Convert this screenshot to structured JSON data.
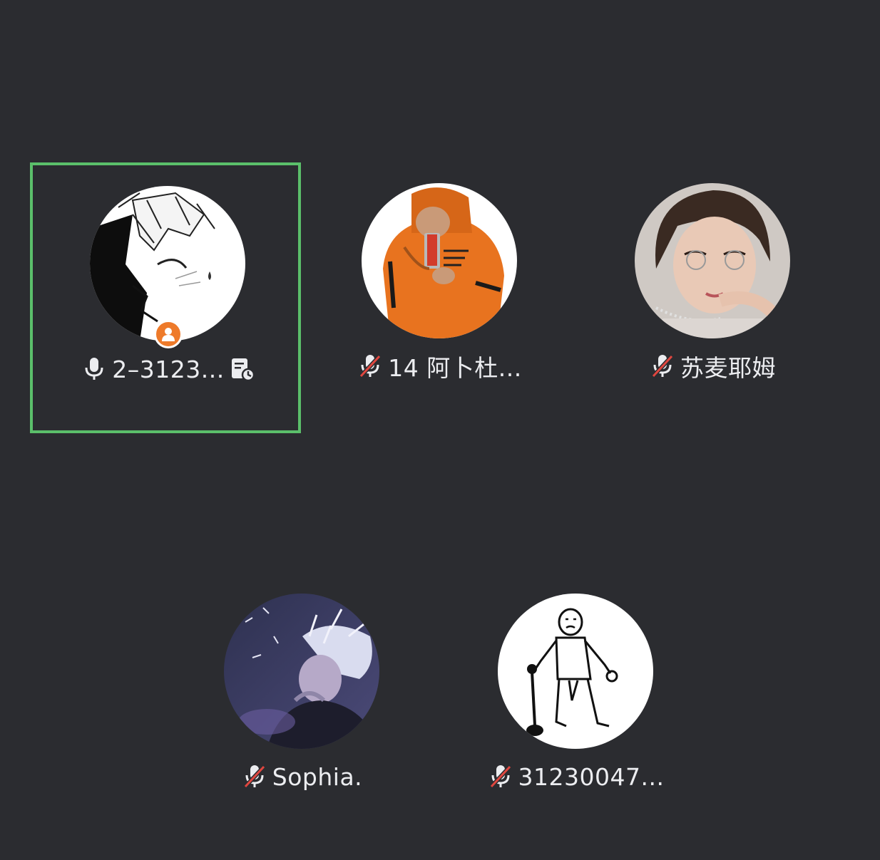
{
  "participants": [
    {
      "name": "2–3123...",
      "mic": "mic-on",
      "speaking": true,
      "host": true,
      "has_share_icon": true
    },
    {
      "name": "14 阿卜杜...",
      "mic": "mic-muted",
      "speaking": false,
      "host": false
    },
    {
      "name": "苏麦耶姆",
      "mic": "mic-muted",
      "speaking": false,
      "host": false
    },
    {
      "name": "Sophia.",
      "mic": "mic-muted",
      "speaking": false,
      "host": false
    },
    {
      "name": "31230047...",
      "mic": "mic-muted",
      "speaking": false,
      "host": false
    }
  ],
  "colors": {
    "background": "#2b2c30",
    "speaking_border": "#5bbf6a",
    "host_badge": "#ee7a2a",
    "muted_slash": "#e0463f",
    "text": "#ecedf0"
  }
}
